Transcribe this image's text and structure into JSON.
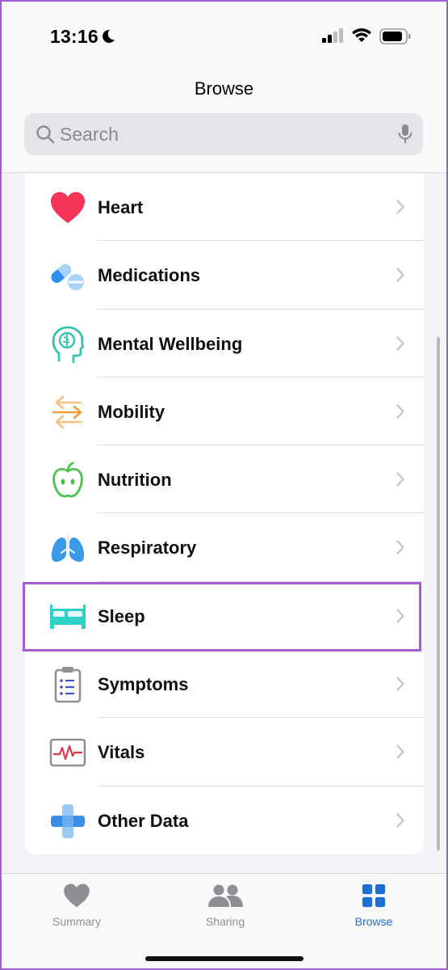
{
  "status_bar": {
    "time": "13:16"
  },
  "header": {
    "title": "Browse"
  },
  "search": {
    "placeholder": "Search"
  },
  "categories": [
    {
      "label": "Heart",
      "icon": "heart-icon"
    },
    {
      "label": "Medications",
      "icon": "pills-icon"
    },
    {
      "label": "Mental Wellbeing",
      "icon": "head-brain-icon"
    },
    {
      "label": "Mobility",
      "icon": "arrows-icon"
    },
    {
      "label": "Nutrition",
      "icon": "apple-icon"
    },
    {
      "label": "Respiratory",
      "icon": "lungs-icon"
    },
    {
      "label": "Sleep",
      "icon": "bed-icon"
    },
    {
      "label": "Symptoms",
      "icon": "clipboard-icon"
    },
    {
      "label": "Vitals",
      "icon": "vitals-chart-icon"
    },
    {
      "label": "Other Data",
      "icon": "plus-icon"
    }
  ],
  "highlighted_item": "Sleep",
  "tab_bar": {
    "tabs": [
      {
        "label": "Summary",
        "icon": "heart-icon",
        "active": false
      },
      {
        "label": "Sharing",
        "icon": "people-icon",
        "active": false
      },
      {
        "label": "Browse",
        "icon": "grid-icon",
        "active": true
      }
    ]
  },
  "colors": {
    "highlight": "#a35bd6",
    "accent": "#1d6fd6",
    "heart": "#f5345a",
    "sleep": "#2fd0c6"
  }
}
